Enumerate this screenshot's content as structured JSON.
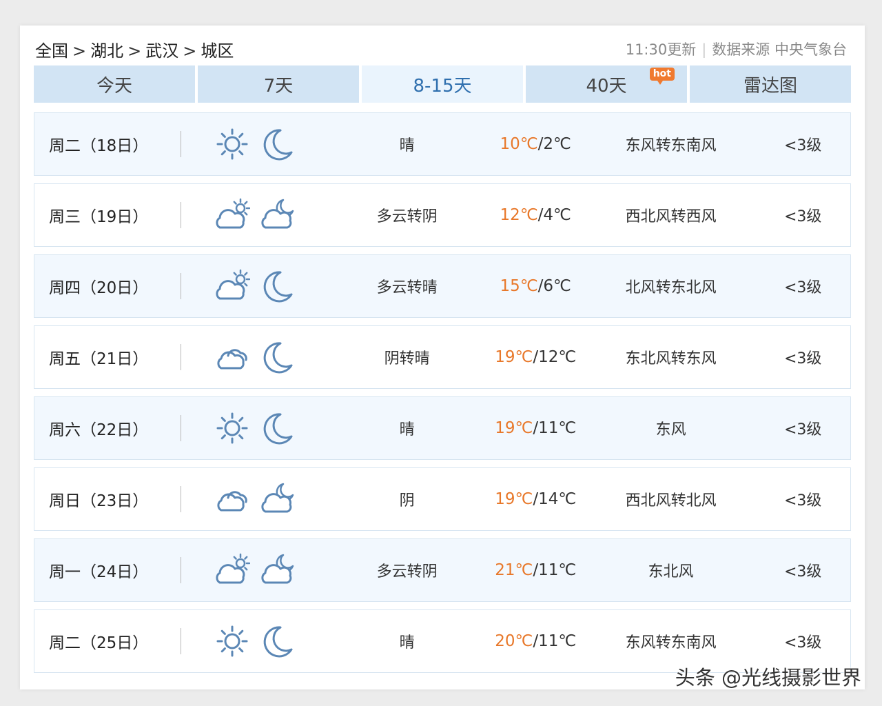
{
  "breadcrumb": [
    "全国",
    "湖北",
    "武汉",
    "城区"
  ],
  "breadcrumb_separator": ">",
  "update_time": "11:30更新",
  "source_label": "数据来源",
  "source_name": "中央气象台",
  "tabs": [
    {
      "label": "今天",
      "active": false,
      "badge": ""
    },
    {
      "label": "7天",
      "active": false,
      "badge": ""
    },
    {
      "label": "8-15天",
      "active": true,
      "badge": ""
    },
    {
      "label": "40天",
      "active": false,
      "badge": "hot"
    },
    {
      "label": "雷达图",
      "active": false,
      "badge": ""
    }
  ],
  "forecast": [
    {
      "date": "周二（18日）",
      "day_icon": "sun-icon",
      "night_icon": "moon-icon",
      "condition": "晴",
      "high": "10℃",
      "low": "2℃",
      "wind": "东风转东南风",
      "level": "<3级"
    },
    {
      "date": "周三（19日）",
      "day_icon": "partly-cloudy-day-icon",
      "night_icon": "cloudy-night-icon",
      "condition": "多云转阴",
      "high": "12℃",
      "low": "4℃",
      "wind": "西北风转西风",
      "level": "<3级"
    },
    {
      "date": "周四（20日）",
      "day_icon": "partly-cloudy-day-icon",
      "night_icon": "moon-icon",
      "condition": "多云转晴",
      "high": "15℃",
      "low": "6℃",
      "wind": "北风转东北风",
      "level": "<3级"
    },
    {
      "date": "周五（21日）",
      "day_icon": "overcast-icon",
      "night_icon": "moon-icon",
      "condition": "阴转晴",
      "high": "19℃",
      "low": "12℃",
      "wind": "东北风转东风",
      "level": "<3级"
    },
    {
      "date": "周六（22日）",
      "day_icon": "sun-icon",
      "night_icon": "moon-icon",
      "condition": "晴",
      "high": "19℃",
      "low": "11℃",
      "wind": "东风",
      "level": "<3级"
    },
    {
      "date": "周日（23日）",
      "day_icon": "overcast-icon",
      "night_icon": "cloudy-night-icon",
      "condition": "阴",
      "high": "19℃",
      "low": "14℃",
      "wind": "西北风转北风",
      "level": "<3级"
    },
    {
      "date": "周一（24日）",
      "day_icon": "partly-cloudy-day-icon",
      "night_icon": "cloudy-night-icon",
      "condition": "多云转阴",
      "high": "21℃",
      "low": "11℃",
      "wind": "东北风",
      "level": "<3级"
    },
    {
      "date": "周二（25日）",
      "day_icon": "sun-icon",
      "night_icon": "moon-icon",
      "condition": "晴",
      "high": "20℃",
      "low": "11℃",
      "wind": "东风转东南风",
      "level": "<3级"
    }
  ],
  "watermark": "头条 @光线摄影世界",
  "colors": {
    "accent": "#2f6fae",
    "high_temp": "#e8782a",
    "tab_bg": "#d2e4f4",
    "row_alt_bg": "#f2f8fe",
    "icon_stroke": "#5b87b5"
  }
}
